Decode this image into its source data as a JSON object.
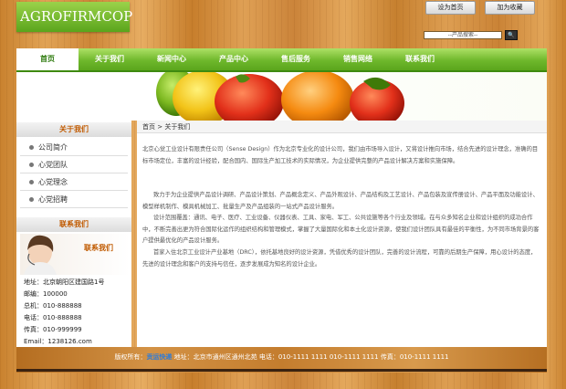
{
  "site": {
    "logo_text": "AGROFIRMCOP"
  },
  "top_links": {
    "home": "设为首页",
    "favorite": "加为收藏"
  },
  "search": {
    "value": "--产品搜索--",
    "button": "🔍"
  },
  "nav": {
    "items": [
      "首页",
      "关于我们",
      "新闻中心",
      "产品中心",
      "售后服务",
      "销售网络",
      "联系我们"
    ]
  },
  "sidebar": {
    "title": "关于我们",
    "items": [
      "公司简介",
      "心党团队",
      "心党理念",
      "心党招聘"
    ],
    "contact_title": "联系我们",
    "contact_label": "联系我们",
    "contact_lines": [
      "地址：北京朝阳区建国路1号",
      "邮编：100000",
      "总机：010-888888",
      "电话：010-888888",
      "传真：010-999999",
      "Email：1238126.com"
    ]
  },
  "breadcrumb": "首页 > 关于我们",
  "content": {
    "paragraphs": [
      "北京心觉工业设计有限责任公司（Sense Design）作为北京专业化的设计公司，我们由市场导入设计，又将设计推向市场，结合先进的设计理念，准确的目标市场定位，丰富的设计经验，配合国内、国际生产加工技术的实际情况，为企业提供完整的产品设计解决方案和实施保障。",
      "致力于为企业提供产品设计调研、产品设计策划、产品概念定义、产品外观设计、产品结构及工艺设计、产品包装及宣传册设计、产品平面及功能设计、模型样机制作、模具机械加工、批量生产及产品组装的一站式产品设计服务。",
      "设计范围覆盖：通讯、电子、医疗、工业设备、仪器仪表、工具、家电、军工、公共设施等各个行业及领域。在与众多知名企业和设计组织的成功合作中，不断完善出更为符合国际化运作的组织结构和管理模式，掌握了大量国际化和本土化设计资源，使我们设计团队具有最佳的平衡性，为不同市场背景的客户提供最优化的产品设计服务。",
      "首家入住北京工业设计产业基地（DRC），依托基地良好的设计资源，凭借优秀的设计团队，完善的设计流程，可靠的后期生产保障，用心设计的态度，先进的设计理念和客户的支持与信任，逐步发展成为知名的设计企业。"
    ]
  },
  "footer": {
    "prefix": "版权所有：",
    "brand": "贡运快递",
    "rest": " 地址：北京市通州区通州北苑  电话：010-1111 1111  010-1111 1111  传真：010-1111 1111"
  },
  "colors": {
    "nav_green": "#6fb82c",
    "accent_orange": "#c05a00",
    "link_blue": "#2a7bdc"
  }
}
